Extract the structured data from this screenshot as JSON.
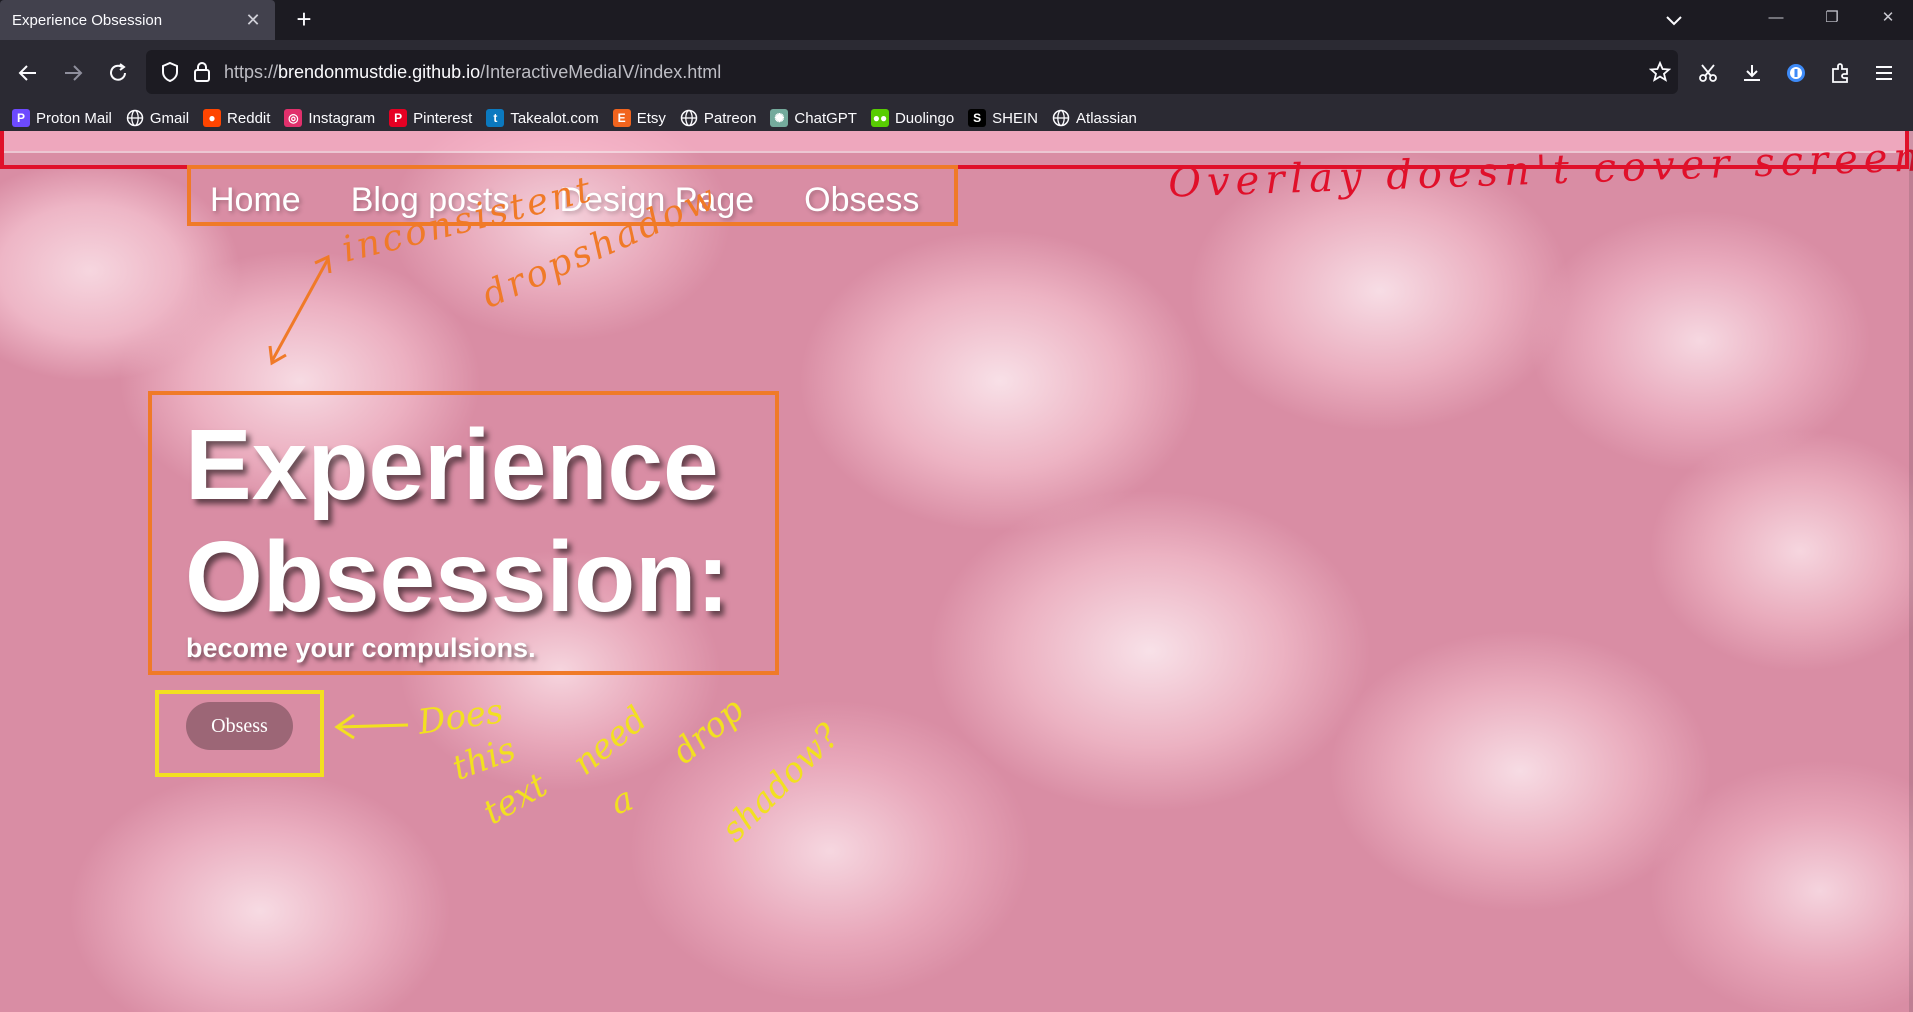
{
  "browser": {
    "tab_title": "Experience Obsession",
    "tab_close": "✕",
    "new_tab": "+",
    "url_scheme": "https://",
    "url_host": "brendonmustdie.github.io",
    "url_path": "/InteractiveMediaIV/index.html",
    "window_buttons": {
      "minimize": "—",
      "restore": "❐",
      "close": "✕"
    },
    "bookmarks": [
      {
        "label": "Proton Mail",
        "icon": "proton-icon",
        "color": "#6d4aff",
        "glyph": "P"
      },
      {
        "label": "Gmail",
        "icon": "globe-icon",
        "color": "",
        "glyph": ""
      },
      {
        "label": "Reddit",
        "icon": "reddit-icon",
        "color": "#ff4500",
        "glyph": "●"
      },
      {
        "label": "Instagram",
        "icon": "instagram-icon",
        "color": "#e1306c",
        "glyph": "◎"
      },
      {
        "label": "Pinterest",
        "icon": "pinterest-icon",
        "color": "#e60023",
        "glyph": "P"
      },
      {
        "label": "Takealot.com",
        "icon": "takealot-icon",
        "color": "#0b79bf",
        "glyph": "t"
      },
      {
        "label": "Etsy",
        "icon": "etsy-icon",
        "color": "#f1641e",
        "glyph": "E"
      },
      {
        "label": "Patreon",
        "icon": "globe-icon",
        "color": "",
        "glyph": ""
      },
      {
        "label": "ChatGPT",
        "icon": "chatgpt-icon",
        "color": "#74aa9c",
        "glyph": "✺"
      },
      {
        "label": "Duolingo",
        "icon": "duolingo-icon",
        "color": "#58cc02",
        "glyph": "●●"
      },
      {
        "label": "SHEIN",
        "icon": "shein-icon",
        "color": "#000000",
        "glyph": "S"
      },
      {
        "label": "Atlassian",
        "icon": "globe-icon",
        "color": "",
        "glyph": ""
      }
    ]
  },
  "site": {
    "nav": [
      "Home",
      "Blog posts",
      "Design Page",
      "Obsess"
    ],
    "hero_line1": "Experience",
    "hero_line2": "Obsession:",
    "subtitle": "become your compulsions.",
    "cta_label": "Obsess"
  },
  "annotations": {
    "overlay_note": "Overlay doesn't cover screen?",
    "dropshadow_note_line1": "inconsistent",
    "dropshadow_note_line2": "dropshadow",
    "button_note_lines": [
      "Does",
      "this",
      "text",
      "need",
      "a",
      "drop",
      "shadow?"
    ],
    "colors": {
      "red": "#e0102a",
      "orange": "#f07a28",
      "yellow": "#f2e020"
    }
  }
}
